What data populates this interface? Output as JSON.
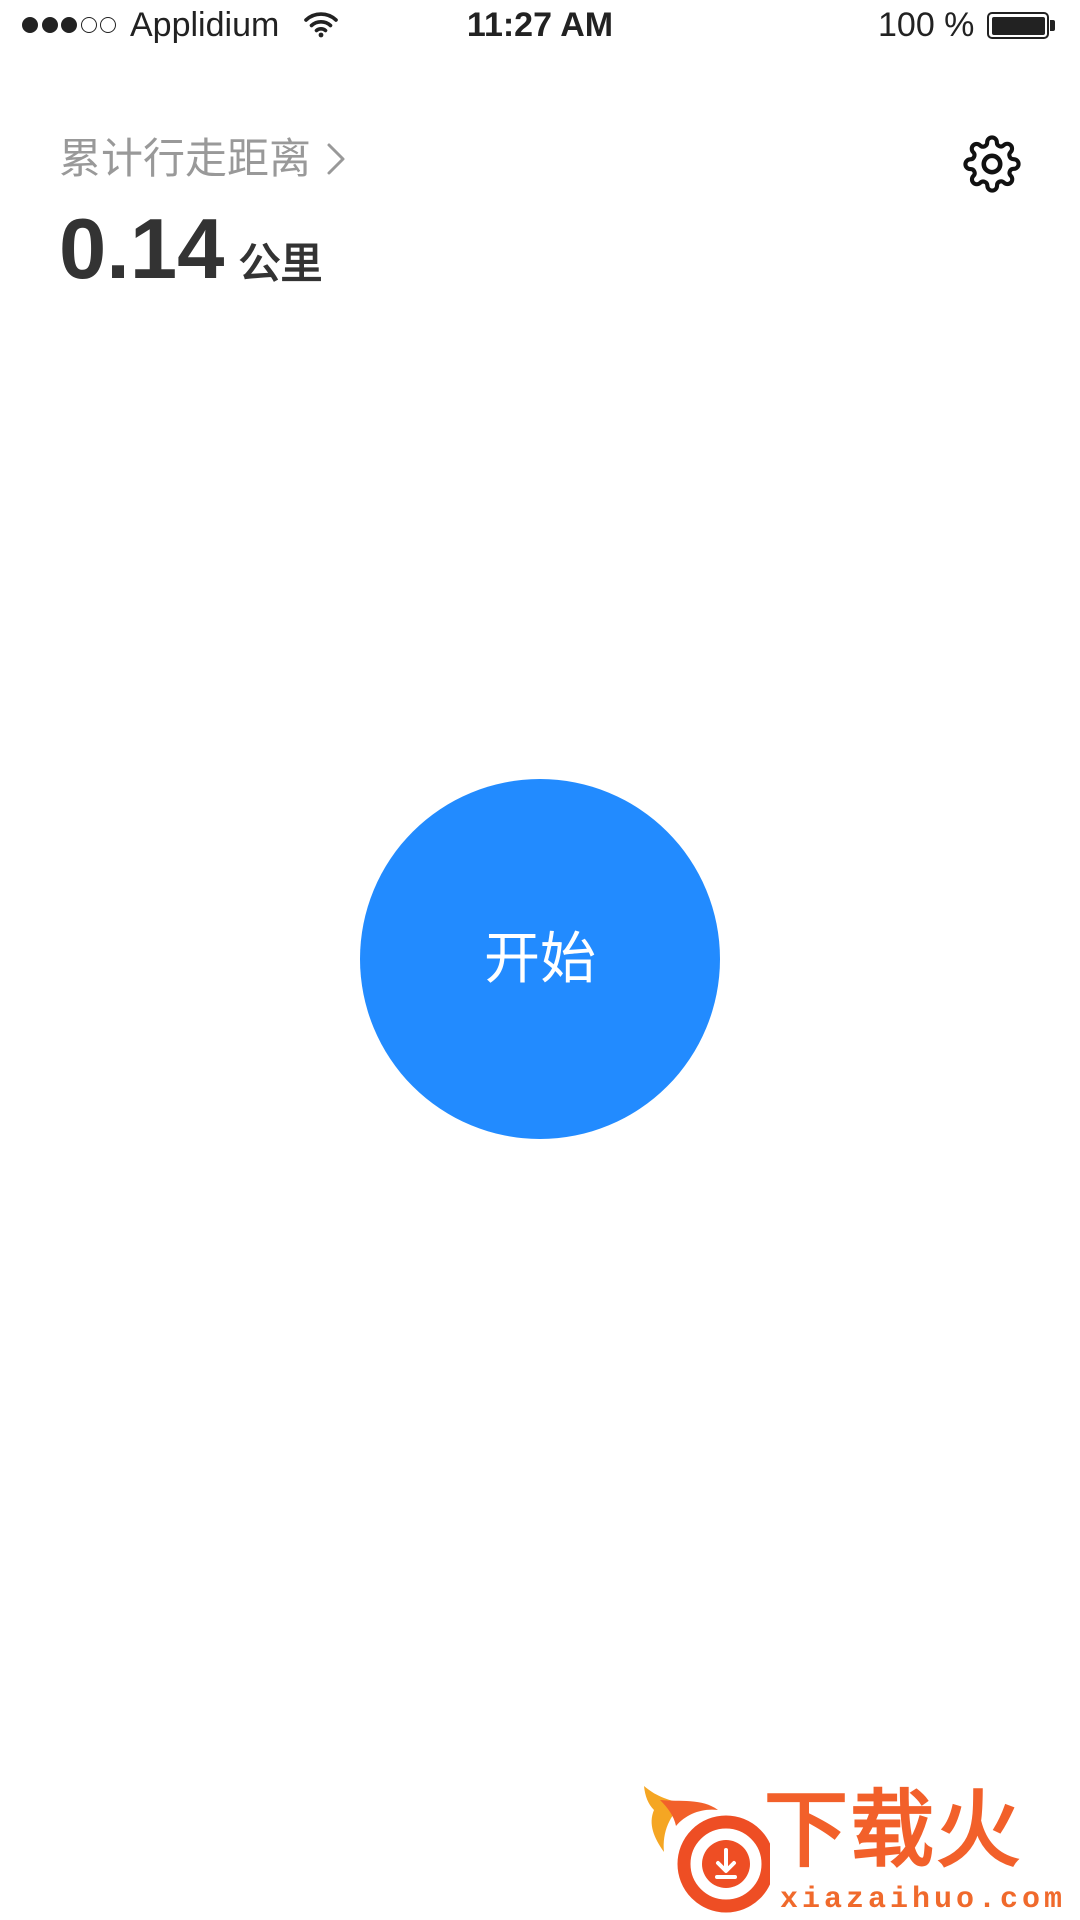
{
  "status_bar": {
    "signal": {
      "filled": 3,
      "total": 5
    },
    "carrier": "Applidium",
    "time": "11:27 AM",
    "battery_text": "100 %",
    "battery_level": 1.0
  },
  "header": {
    "distance_label": "累计行走距离",
    "distance_value": "0.14",
    "distance_unit": "公里"
  },
  "start_button": {
    "label": "开始"
  },
  "watermark": {
    "brand": "下载火",
    "domain": "xiazaihuo.com"
  },
  "icons": {
    "signal": "signal-dots-icon",
    "wifi": "wifi-icon",
    "battery": "battery-icon",
    "distance_chevron": "chevron-right-icon",
    "settings": "gear-icon",
    "watermark_logo": "download-flame-logo"
  },
  "colors": {
    "accent": "#228BFF",
    "label_gray": "#999999",
    "text_dark": "#333333",
    "watermark_orange": "#F2602A"
  }
}
